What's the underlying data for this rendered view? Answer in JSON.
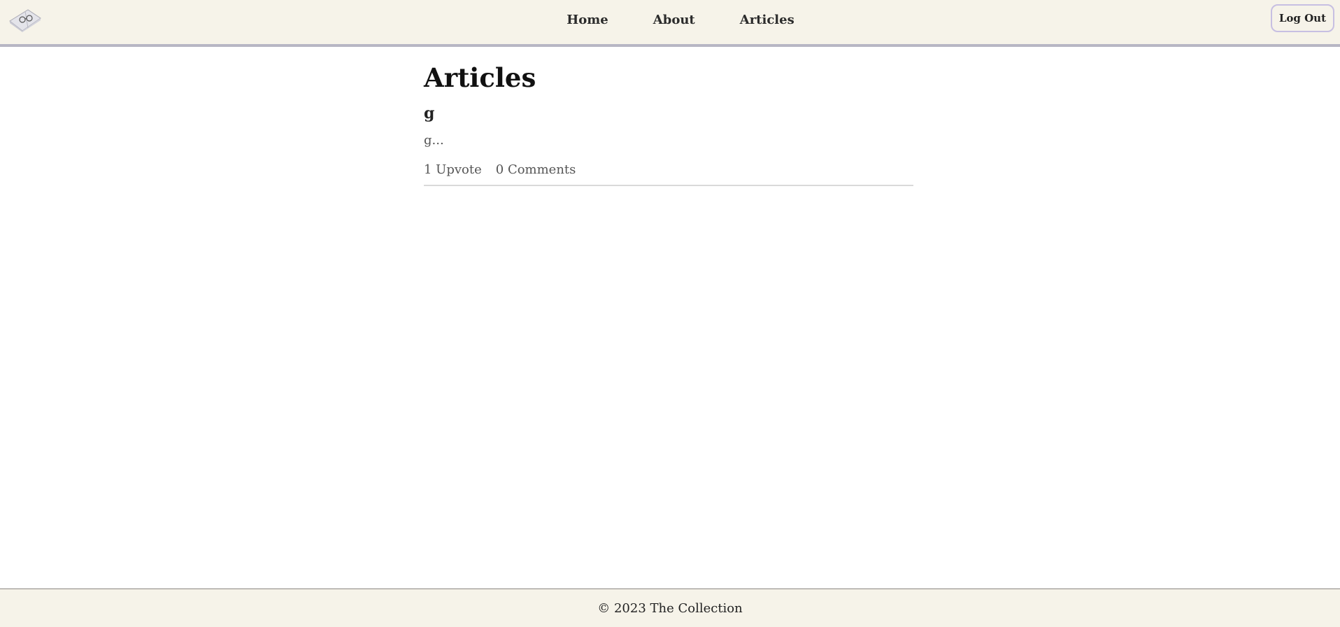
{
  "header": {
    "logo_icon": "open-book-with-glasses-icon",
    "nav": [
      {
        "label": "Home"
      },
      {
        "label": "About"
      },
      {
        "label": "Articles"
      }
    ],
    "logout_label": "Log Out"
  },
  "main": {
    "title": "Articles",
    "articles": [
      {
        "title": "g",
        "excerpt": "g...",
        "upvotes": "1 Upvote",
        "comments": "0 Comments"
      }
    ]
  },
  "footer": {
    "text": "© 2023 The Collection"
  },
  "colors": {
    "header_bg": "#f6f3e9",
    "header_border": "#b7b6c4",
    "button_border": "#c7bfe2",
    "divider": "#d9d9d9"
  }
}
